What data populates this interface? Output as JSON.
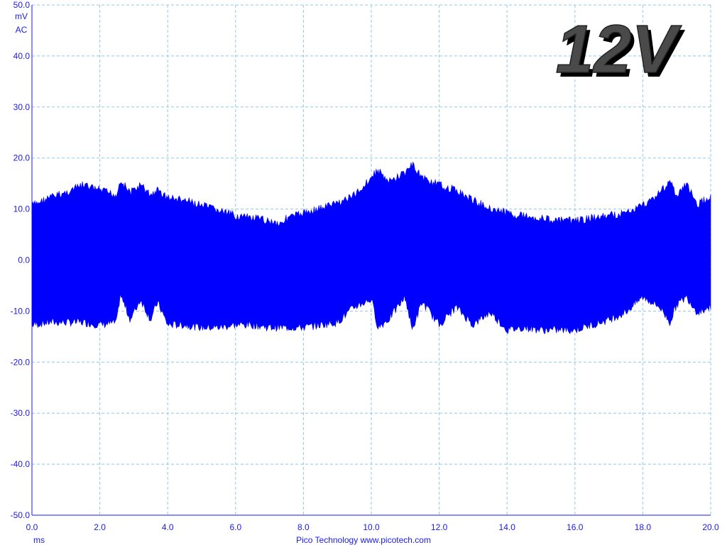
{
  "chart_data": {
    "type": "area",
    "title": "",
    "badge": "12V",
    "y_unit": "mV",
    "y_coupling": "AC",
    "x_unit": "ms",
    "credit": "Pico Technology  www.picotech.com",
    "xlim": [
      0,
      20
    ],
    "ylim": [
      -50,
      50
    ],
    "x_ticks": [
      "0.0",
      "2.0",
      "4.0",
      "6.0",
      "8.0",
      "10.0",
      "12.0",
      "14.0",
      "16.0",
      "18.0",
      "20.0"
    ],
    "y_ticks": [
      "50.0",
      "40.0",
      "30.0",
      "20.0",
      "10.0",
      "0.0",
      "-10.0",
      "-20.0",
      "-30.0",
      "-40.0",
      "-50.0"
    ],
    "grid": true,
    "series": [
      {
        "color": "#0000ff",
        "x": [
          0.0,
          0.5,
          1.0,
          1.5,
          2.0,
          2.5,
          2.6,
          2.9,
          3.2,
          3.5,
          3.7,
          4.0,
          4.5,
          5.0,
          5.5,
          6.0,
          6.5,
          7.0,
          7.3,
          7.5,
          8.0,
          8.5,
          9.0,
          9.5,
          10.0,
          10.2,
          10.5,
          11.0,
          11.2,
          11.5,
          12.0,
          12.5,
          13.0,
          13.5,
          14.0,
          14.5,
          15.0,
          15.5,
          16.0,
          16.5,
          17.0,
          17.5,
          18.0,
          18.5,
          18.8,
          19.0,
          19.3,
          19.6,
          20.0
        ],
        "upper": [
          11.5,
          13.0,
          14.0,
          15.5,
          14.5,
          13.5,
          16.5,
          14.0,
          15.5,
          13.5,
          14.5,
          13.0,
          12.5,
          11.5,
          10.5,
          9.5,
          9.0,
          8.5,
          8.0,
          9.0,
          10.0,
          11.0,
          12.0,
          13.5,
          17.0,
          18.5,
          16.0,
          18.0,
          19.5,
          17.0,
          15.5,
          14.5,
          12.5,
          11.0,
          10.0,
          9.5,
          9.0,
          8.5,
          8.5,
          9.0,
          9.5,
          10.0,
          11.5,
          14.0,
          16.5,
          13.0,
          16.0,
          11.5,
          13.5
        ],
        "lower": [
          -13.5,
          -13.0,
          -13.0,
          -13.0,
          -13.5,
          -13.0,
          -7.5,
          -12.5,
          -8.5,
          -12.5,
          -9.0,
          -13.5,
          -13.5,
          -14.0,
          -14.0,
          -13.5,
          -13.5,
          -14.0,
          -14.0,
          -14.0,
          -14.0,
          -13.5,
          -13.0,
          -10.0,
          -8.5,
          -14.0,
          -12.5,
          -8.0,
          -14.5,
          -9.0,
          -13.5,
          -10.0,
          -13.5,
          -11.0,
          -14.5,
          -14.0,
          -14.5,
          -14.5,
          -14.5,
          -13.5,
          -12.5,
          -11.0,
          -8.0,
          -10.0,
          -13.0,
          -9.5,
          -8.0,
          -11.0,
          -10.0
        ]
      }
    ]
  }
}
